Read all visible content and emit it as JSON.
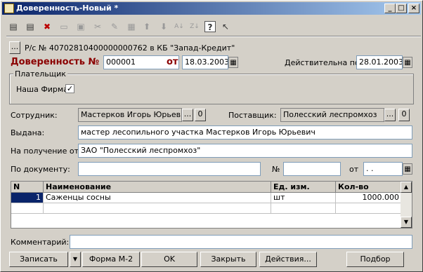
{
  "window": {
    "title": "Доверенность-Новый *",
    "min": "_",
    "max": "□",
    "close": "×"
  },
  "toolbar": {
    "icons": [
      "new-doc-icon",
      "add-row-icon",
      "delete-row-icon",
      "copy-icon",
      "paste-icon",
      "cut-icon",
      "edit-icon",
      "insert-icon",
      "up-icon",
      "down-icon",
      "sort-asc-icon",
      "sort-desc-icon",
      "help-icon",
      "pointer-help-icon"
    ],
    "glyphs": [
      "▤",
      "▤",
      "✖",
      "▭",
      "▣",
      "✂",
      "✎",
      "▦",
      "⬆",
      "⬇",
      "A↓",
      "Z↓",
      "?",
      "↖"
    ]
  },
  "account": {
    "button": "...",
    "text": "Р/с № 40702810400000000762 в КБ \"Запад-Кредит\""
  },
  "doc": {
    "title_label": "Доверенность №",
    "number": "000001",
    "from_label": "от",
    "date": "18.03.2003",
    "valid_label": "Действительна по:",
    "valid_date": "28.01.2003"
  },
  "payer": {
    "group_title": "Плательщик",
    "label": "Наша Фирма",
    "checked": "✓"
  },
  "employee": {
    "label": "Сотрудник:",
    "value": "Мастерков Игорь Юрьевич",
    "btn": "...",
    "clear": "0"
  },
  "supplier": {
    "label": "Поставщик:",
    "value": "Полесский леспромхоз",
    "btn": "...",
    "clear": "0"
  },
  "issued": {
    "label": "Выдана:",
    "value": "мастер лесопильного участка Мастерков Игорь Юрьевич"
  },
  "receive": {
    "label": "На получение от:",
    "value": "ЗАО \"Полесский леспромхоз\""
  },
  "bydoc": {
    "label": "По документу:",
    "value": "",
    "num_label": "№",
    "num_value": "",
    "from_label": "от",
    "date_value": " .  . "
  },
  "table": {
    "headers": [
      "N",
      "Наименование",
      "Ед. изм.",
      "Кол-во"
    ],
    "rows": [
      {
        "n": "1",
        "name": "Саженцы сосны",
        "unit": "шт",
        "qty": "1000.000"
      }
    ]
  },
  "comment": {
    "label": "Комментарий:",
    "value": ""
  },
  "buttons": {
    "record": "Записать",
    "dropdown": "▼",
    "form": "Форма М-2",
    "ok": "OK",
    "close": "Закрыть",
    "actions": "Действия...",
    "select": "Подбор"
  },
  "calendar_glyph": "▦"
}
